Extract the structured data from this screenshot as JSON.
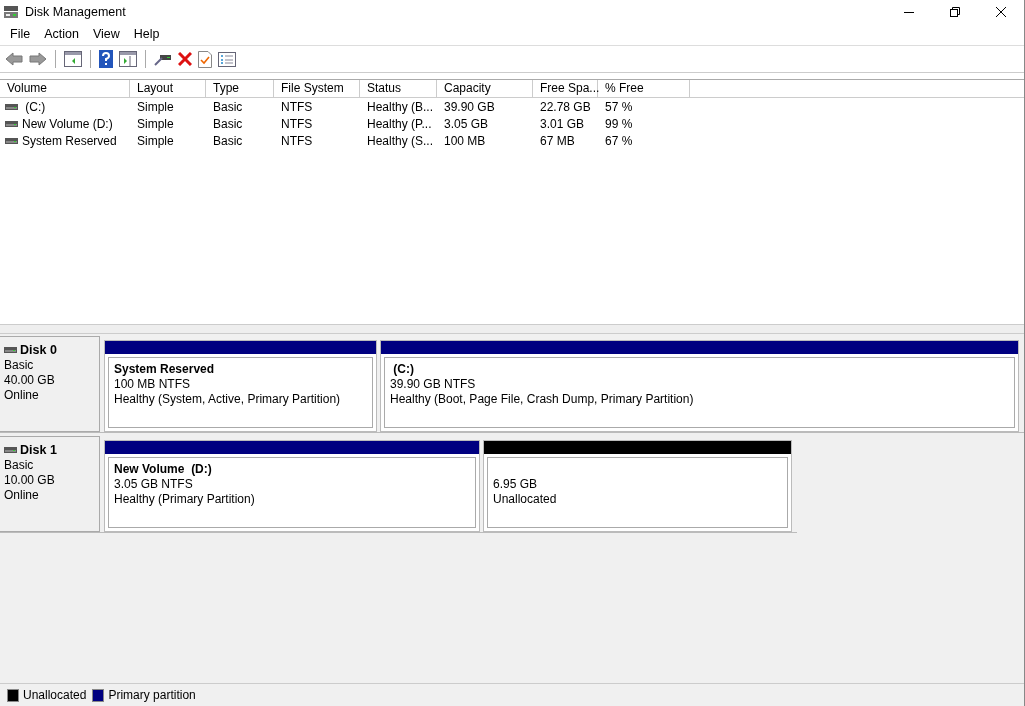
{
  "window": {
    "title": "Disk Management"
  },
  "menu": [
    "File",
    "Action",
    "View",
    "Help"
  ],
  "table": {
    "columns": [
      "Volume",
      "Layout",
      "Type",
      "File System",
      "Status",
      "Capacity",
      "Free Spa...",
      "% Free"
    ],
    "rows": [
      {
        "cells": [
          " (C:)",
          "Simple",
          "Basic",
          "NTFS",
          "Healthy (B...",
          "39.90 GB",
          "22.78 GB",
          "57 %"
        ]
      },
      {
        "cells": [
          "New Volume (D:)",
          "Simple",
          "Basic",
          "NTFS",
          "Healthy (P...",
          "3.05 GB",
          "3.01 GB",
          "99 %"
        ]
      },
      {
        "cells": [
          "System Reserved",
          "Simple",
          "Basic",
          "NTFS",
          "Healthy (S...",
          "100 MB",
          "67 MB",
          "67 %"
        ]
      }
    ]
  },
  "disks": [
    {
      "name": "Disk 0",
      "type": "Basic",
      "size": "40.00 GB",
      "status": "Online",
      "partitions": [
        {
          "color": "#000080",
          "label": "System Reserved",
          "size": "100 MB NTFS",
          "status": "Healthy (System, Active, Primary Partition)"
        },
        {
          "color": "#000080",
          "label": " (C:)",
          "size": "39.90 GB NTFS",
          "status": "Healthy (Boot, Page File, Crash Dump, Primary Partition)"
        }
      ]
    },
    {
      "name": "Disk 1",
      "type": "Basic",
      "size": "10.00 GB",
      "status": "Online",
      "partitions": [
        {
          "color": "#000080",
          "label": "New Volume  (D:)",
          "size": "3.05 GB NTFS",
          "status": "Healthy (Primary Partition)"
        },
        {
          "color": "#000000",
          "size": "6.95 GB",
          "status": "Unallocated"
        }
      ]
    }
  ],
  "legend": [
    {
      "color": "#000000",
      "label": "Unallocated"
    },
    {
      "color": "#000080",
      "label": "Primary partition"
    }
  ]
}
